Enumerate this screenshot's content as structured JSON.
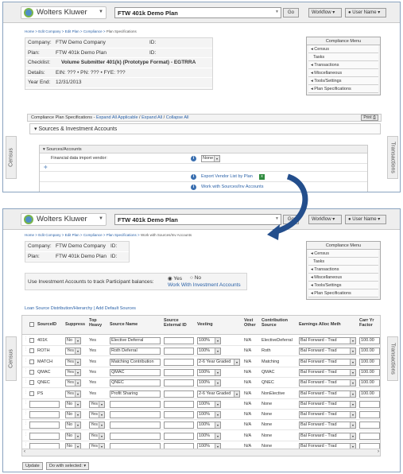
{
  "brand": "Wolters Kluwer",
  "plan_select": "FTW 401k Demo Plan",
  "go_label": "Go",
  "workflow_label": "Workflow",
  "user_label": "User Name",
  "side_left": "Census",
  "side_right": "Transactions",
  "compliance_menu": {
    "title": "Compliance Menu",
    "items": [
      "Census",
      "Tasks",
      "Transactions",
      "Miscellaneous",
      "Tools/Settings",
      "Plan Specifications"
    ]
  },
  "screen1": {
    "breadcrumb": {
      "home": "Home",
      "sep": ">",
      "edit_company": "Edit Company",
      "edit_plan": "Edit Plan",
      "compliance": "Compliance",
      "current": "Plan Specifications"
    },
    "company_label": "Company:",
    "company_value": "FTW Demo Company",
    "company_id": "ID:",
    "plan_label": "Plan:",
    "plan_value": "FTW 401k Demo Plan",
    "plan_id": "ID:",
    "checklist_label": "Checklist:",
    "checklist_value": "Volume Submitter 401(k) (Prototype Format) - EGTRRA",
    "details_label": "Details:",
    "details_value": "EIN: ??? • PN: ??? • FYE: ???",
    "yearend_label": "Year End:",
    "yearend_value": "12/31/2013",
    "spec_title": "Compliance Plan Specifications",
    "expand_applicable": "Expand All Applicable",
    "expand_all": "Expand All",
    "collapse_all": "Collapse All",
    "print_label": "Print",
    "section_title": "Sources & Investment Accounts",
    "sub_title": "Sources/Accounts",
    "vendor_label": "Financial data import vendor:",
    "vendor_value": "None",
    "export_link": "Export Vendor List by Plan",
    "work_link": "Work with Sources/Inv Accounts"
  },
  "screen2": {
    "breadcrumb": {
      "home": "Home",
      "sep": ">",
      "edit_company": "Edit Company",
      "edit_plan": "Edit Plan",
      "compliance": "Compliance",
      "plan_specs": "Plan Specifications",
      "current": "Work with Sources/Inv Accounts"
    },
    "company_label": "Company:",
    "company_value": "FTW Demo Company",
    "company_id": "ID:",
    "plan_label": "Plan:",
    "plan_value": "FTW 401k Demo Plan",
    "plan_id": "ID:",
    "track_label": "Use Investment Accounts to track Participant balances:",
    "yes_label": "Yes",
    "no_label": "No",
    "work_link": "Work With Investment Accounts",
    "loan_link": "Loan Source Distribution/Hierarchy",
    "add_default_link": "Add Default Sources",
    "columns": [
      "SourceID",
      "Suppress",
      "Top Heavy",
      "Source Name",
      "Source External ID",
      "Vesting",
      "Vest Other",
      "Contribution Source",
      "Earnings Alloc Meth",
      "Carr Yr Factor"
    ],
    "rows": [
      {
        "id": "401K",
        "suppress": "No",
        "top": "Yes",
        "name": "Elective Deferral",
        "ext": "",
        "vesting": "100%",
        "vest_other": "N/A",
        "contrib": "ElectiveDeferral",
        "earn": "Bal Forward - Trad",
        "carr": "100.00"
      },
      {
        "id": "ROTH",
        "suppress": "Yes",
        "top": "Yes",
        "name": "Roth Deferral",
        "ext": "",
        "vesting": "100%",
        "vest_other": "N/A",
        "contrib": "Roth",
        "earn": "Bal Forward - Trad",
        "carr": "100.00"
      },
      {
        "id": "MATCH",
        "suppress": "Yes",
        "top": "Yes",
        "name": "Matching Contribution",
        "ext": "",
        "vesting": "2-6 Year Graded",
        "vest_other": "N/A",
        "contrib": "Matching",
        "earn": "Bal Forward - Trad",
        "carr": "100.00"
      },
      {
        "id": "QMAC",
        "suppress": "Yes",
        "top": "Yes",
        "name": "QMAC",
        "ext": "",
        "vesting": "100%",
        "vest_other": "N/A",
        "contrib": "QMAC",
        "earn": "Bal Forward - Trad",
        "carr": "100.00"
      },
      {
        "id": "QNEC",
        "suppress": "Yes",
        "top": "Yes",
        "name": "QNEC",
        "ext": "",
        "vesting": "100%",
        "vest_other": "N/A",
        "contrib": "QNEC",
        "earn": "Bal Forward - Trad",
        "carr": "100.00"
      },
      {
        "id": "PS",
        "suppress": "Yes",
        "top": "Yes",
        "name": "Profit Sharing",
        "ext": "",
        "vesting": "2-6 Year Graded",
        "vest_other": "N/A",
        "contrib": "NonElective",
        "earn": "Bal Forward - Trad",
        "carr": "100.00"
      },
      {
        "id": "",
        "suppress": "No",
        "top": "Yes",
        "name": "",
        "ext": "",
        "vesting": "100%",
        "vest_other": "N/A",
        "contrib": "None",
        "earn": "Bal Forward - Trad",
        "carr": ""
      },
      {
        "id": "",
        "suppress": "No",
        "top": "Yes",
        "name": "",
        "ext": "",
        "vesting": "100%",
        "vest_other": "N/A",
        "contrib": "None",
        "earn": "Bal Forward - Trad",
        "carr": ""
      },
      {
        "id": "",
        "suppress": "No",
        "top": "Yes",
        "name": "",
        "ext": "",
        "vesting": "100%",
        "vest_other": "N/A",
        "contrib": "None",
        "earn": "Bal Forward - Trad",
        "carr": ""
      },
      {
        "id": "",
        "suppress": "No",
        "top": "Yes",
        "name": "",
        "ext": "",
        "vesting": "100%",
        "vest_other": "N/A",
        "contrib": "None",
        "earn": "Bal Forward - Trad",
        "carr": ""
      },
      {
        "id": "",
        "suppress": "No",
        "top": "Yes",
        "name": "",
        "ext": "",
        "vesting": "100%",
        "vest_other": "N/A",
        "contrib": "None",
        "earn": "Bal Forward - Trad",
        "carr": ""
      }
    ],
    "update_label": "Update",
    "do_with_selected": "Do with selected:"
  }
}
